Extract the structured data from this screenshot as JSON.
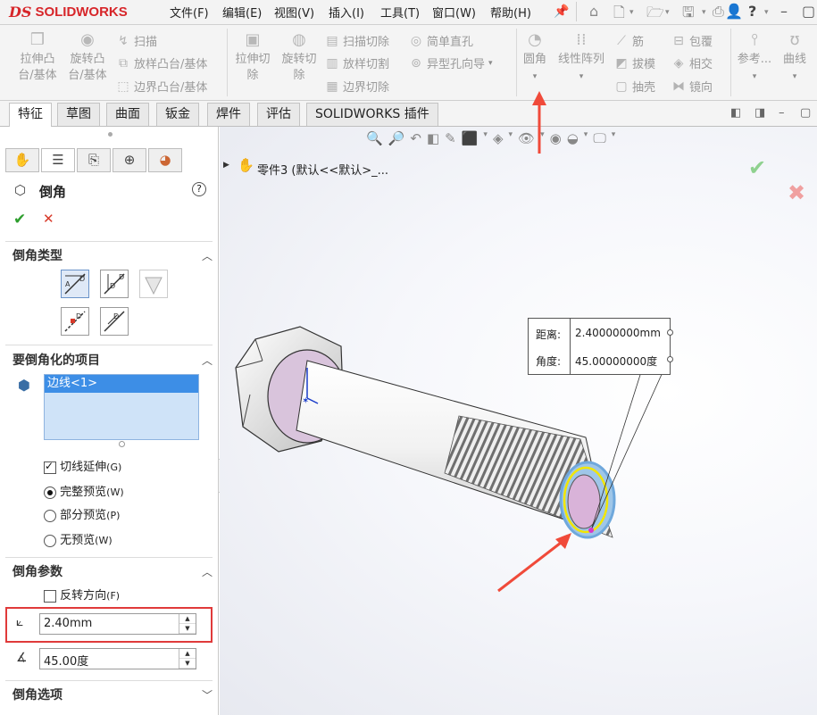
{
  "app": {
    "logo_prefix": "DS",
    "logo_text": "SOLIDWORKS"
  },
  "menu": [
    "文件(F)",
    "编辑(E)",
    "视图(V)",
    "插入(I)",
    "工具(T)",
    "窗口(W)",
    "帮助(H)"
  ],
  "toolbar_icons": [
    "pin-icon",
    "home-icon",
    "new-file-icon",
    "open-folder-icon",
    "save-icon",
    "print-icon",
    "user-icon",
    "help-icon"
  ],
  "ribbon": {
    "boss_extrude": [
      "拉伸凸",
      "台/基体"
    ],
    "revolve_boss": [
      "旋转凸",
      "台/基体"
    ],
    "sweep": "扫描",
    "loft_boss": "放样凸台/基体",
    "boundary_boss": "边界凸台/基体",
    "extruded_cut": [
      "拉伸切",
      "除"
    ],
    "revolved_cut": [
      "旋转切",
      "除"
    ],
    "swept_cut": "扫描切除",
    "lofted_cut": "放样切割",
    "boundary_cut": "边界切除",
    "simple_hole": "简单直孔",
    "hole_wizard": "异型孔向导",
    "fillet": "圆角",
    "linear_pattern": "线性阵列",
    "rib": "筋",
    "draft": "拔模",
    "shell": "抽壳",
    "wrap": "包覆",
    "intersect": "相交",
    "mirror": "镜向",
    "reference": "参考...",
    "curves": "曲线"
  },
  "tabs": [
    "特征",
    "草图",
    "曲面",
    "钣金",
    "焊件",
    "评估",
    "SOLIDWORKS 插件"
  ],
  "tree": {
    "part_label": "零件3  (默认<<默认>_..."
  },
  "property_manager": {
    "title": "倒角",
    "help": "?",
    "ok": "✔",
    "cancel": "✕",
    "chamfer_type_title": "倒角类型",
    "items_title": "要倒角化的项目",
    "selected_items": [
      "边线<1>"
    ],
    "tangent_propagation": "切线延伸",
    "tangent_propagation_key": "(G)",
    "full_preview": "完整预览",
    "full_preview_key": "(W)",
    "partial_preview": "部分预览",
    "partial_preview_key": "(P)",
    "no_preview": "无预览",
    "no_preview_key": "(W)",
    "params_title": "倒角参数",
    "flip_direction": "反转方向",
    "flip_direction_key": "(F)",
    "distance_value": "2.40mm",
    "angle_value": "45.00度",
    "options_title": "倒角选项"
  },
  "callout": {
    "distance_label": "距离:",
    "distance_value": "2.40000000mm",
    "angle_label": "角度:",
    "angle_value": "45.00000000度"
  },
  "colors": {
    "accent": "#d7262a",
    "annotation_red": "#f04a3a",
    "highlight_blue": "#6fa8dc",
    "edge_yellow": "#f2e600",
    "face_pink": "#d9b3d9"
  }
}
